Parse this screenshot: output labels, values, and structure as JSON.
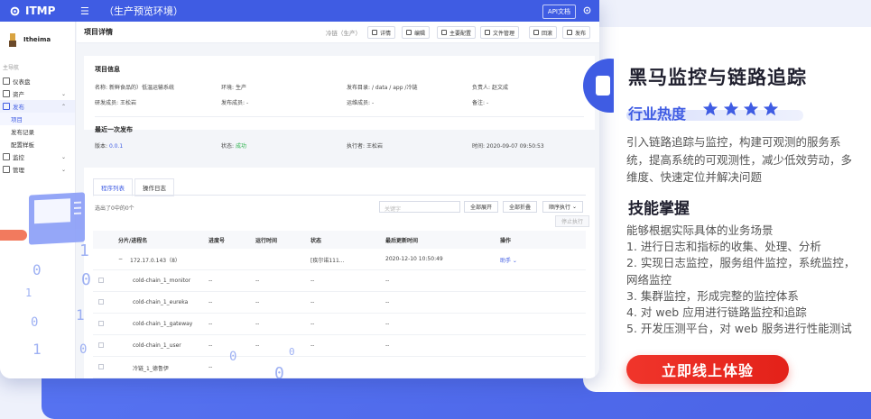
{
  "app": {
    "logo_text": "ITMP",
    "env_title": "（生产预览环境）",
    "api_doc_label": "API文档"
  },
  "sidebar": {
    "user_name": "Itheima",
    "nav_title": "主导航",
    "items": [
      {
        "label": "仪表盘"
      },
      {
        "label": "资产"
      },
      {
        "label": "发布"
      },
      {
        "label": "监控"
      },
      {
        "label": "管理"
      }
    ],
    "sub_items": [
      {
        "label": "项目"
      },
      {
        "label": "发布记录"
      },
      {
        "label": "配置样板"
      }
    ]
  },
  "page": {
    "title": "项目详情",
    "path": "冷链（生产）",
    "toolbar": [
      "详情",
      "编辑",
      "主要配置",
      "文件管理",
      "回滚",
      "发布"
    ]
  },
  "project_info": {
    "title": "项目信息",
    "fields": [
      {
        "key": "名称:",
        "value": "新鲜食品的）低温运输系统"
      },
      {
        "key": "环境:",
        "value": "生产"
      },
      {
        "key": "发布目录:",
        "value": "/ data / app /冷链"
      },
      {
        "key": "负责人:",
        "value": "赵文成"
      },
      {
        "key": "研发成员:",
        "value": "王松岩"
      },
      {
        "key": "发布成员:",
        "value": "-"
      },
      {
        "key": "运维成员:",
        "value": "-"
      },
      {
        "key": "备注:",
        "value": "-"
      }
    ]
  },
  "last_release": {
    "title": "最近一次发布",
    "fields": [
      {
        "key": "版本:",
        "value": "0.0.1"
      },
      {
        "key": "状态:",
        "value": "成功"
      },
      {
        "key": "执行者:",
        "value": "王松岩"
      },
      {
        "key": "时间:",
        "value": "2020-09-07 09:50:53"
      }
    ]
  },
  "list": {
    "tabs": [
      "程序列表",
      "操作日志"
    ],
    "count_text": "选出了0中的0个",
    "search_placeholder": "关键字",
    "buttons": [
      "全部展开",
      "全部折叠",
      "顺序执行"
    ],
    "stop_label": "停止执行",
    "columns": [
      "分片/进程名",
      "进度号",
      "运行时间",
      "状态",
      "最后更新时间",
      "操作"
    ],
    "group_row": {
      "name": "172.17.0.143（8）",
      "status": "[疾尔诺111...",
      "updated": "2020-12-10 10:50:49",
      "action": "助手"
    },
    "rows": [
      {
        "name": "cold-chain_1_monitor",
        "pid": "--",
        "runtime": "--",
        "status": "--",
        "updated": "--"
      },
      {
        "name": "cold-chain_1_eureka",
        "pid": "--",
        "runtime": "--",
        "status": "--",
        "updated": "--"
      },
      {
        "name": "cold-chain_1_gateway",
        "pid": "--",
        "runtime": "--",
        "status": "--",
        "updated": "--"
      },
      {
        "name": "cold-chain_1_user",
        "pid": "--",
        "runtime": "--",
        "status": "--",
        "updated": "--"
      },
      {
        "name": "冷链_1_德鲁伊",
        "pid": "--",
        "runtime": "",
        "status": "",
        "updated": ""
      }
    ]
  },
  "marketing": {
    "title": "黑马监控与链路追踪",
    "heat_label": "行业热度",
    "stars": 4,
    "desc": "引入链路追踪与监控，构建可观测的服务系统，提高系统的可观测性，减少低效劳动，多维度、快速定位并解决问题",
    "skills_title": "技能掌握",
    "skills_intro": "能够根据实际具体的业务场景",
    "skills": [
      "1. 进行日志和指标的收集、处理、分析",
      "2. 实现日志监控，服务组件监控，系统监控，网络监控",
      "3. 集群监控，形成完整的监控体系",
      "4. 对 web 应用进行链路监控和追踪",
      "5. 开发压测平台，对 web 服务进行性能测试"
    ],
    "cta_label": "立即线上体验"
  },
  "colors": {
    "primary": "#3f5ce3",
    "success": "#2bb24c",
    "cta": "#e32119"
  }
}
